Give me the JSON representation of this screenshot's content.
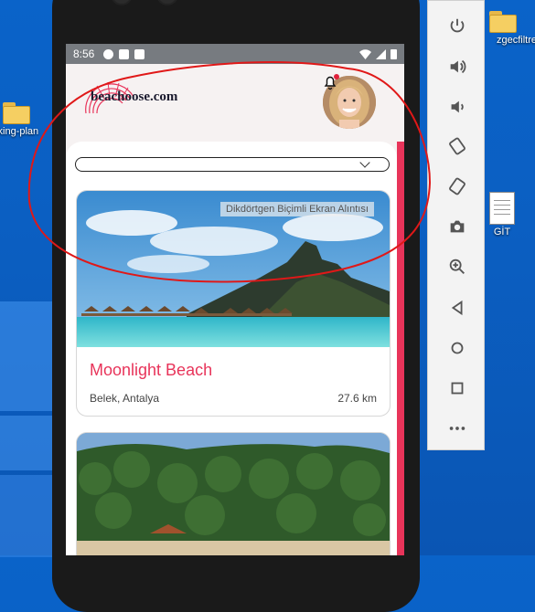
{
  "desktop": {
    "icons": [
      {
        "label": "rking-plan",
        "kind": "folder"
      },
      {
        "label": "zgecfiltre",
        "kind": "folder"
      },
      {
        "label": "GİT",
        "kind": "document"
      }
    ],
    "snip_window_label": "Dikdörtgen Biçimli Ekran Alıntısı"
  },
  "emulator_toolbar": {
    "buttons": [
      "power-icon",
      "volume-up-icon",
      "volume-down-icon",
      "rotate-left-icon",
      "rotate-right-icon",
      "camera-icon",
      "zoom-icon",
      "back-icon",
      "home-icon",
      "overview-icon",
      "more-icon"
    ]
  },
  "status_bar": {
    "time": "8:56"
  },
  "app": {
    "logo_text": "beachoose.com",
    "notification_badge": true,
    "dropdown": {
      "value": ""
    }
  },
  "cards": [
    {
      "title": "Moonlight Beach",
      "location": "Belek, Antalya",
      "distance": "27.6 km"
    },
    {
      "title": "",
      "location": "",
      "distance": ""
    }
  ],
  "colors": {
    "accent": "#e8345a",
    "annotation": "#e01818"
  }
}
